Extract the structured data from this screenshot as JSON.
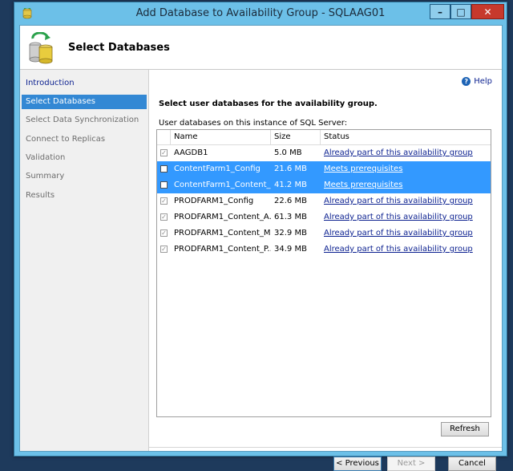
{
  "window": {
    "title": "Add Database to Availability Group - SQLAAG01",
    "controls": {
      "minimize": "–",
      "maximize": "□",
      "close": "✕"
    }
  },
  "header": {
    "title": "Select Databases",
    "icon": "database-cylinders-icon"
  },
  "nav": {
    "items": [
      {
        "label": "Introduction"
      },
      {
        "label": "Select Databases"
      },
      {
        "label": "Select Data Synchronization"
      },
      {
        "label": "Connect to Replicas"
      },
      {
        "label": "Validation"
      },
      {
        "label": "Summary"
      },
      {
        "label": "Results"
      }
    ]
  },
  "main": {
    "help_label": "Help",
    "section_title": "Select user databases for the availability group.",
    "grid_label": "User databases on this instance of SQL Server:",
    "columns": {
      "name": "Name",
      "size": "Size",
      "status": "Status"
    },
    "rows": [
      {
        "name": "AAGDB1",
        "size": "5.0 MB",
        "status": "Already part of this availability group",
        "checked": true,
        "selected": false
      },
      {
        "name": "ContentFarm1_Config",
        "size": "21.6 MB",
        "status": "Meets prerequisites",
        "checked": false,
        "selected": true
      },
      {
        "name": "ContentFarm1_Content_...",
        "size": "41.2 MB",
        "status": "Meets prerequisites",
        "checked": false,
        "selected": true
      },
      {
        "name": "PRODFARM1_Config",
        "size": "22.6 MB",
        "status": "Already part of this availability group",
        "checked": true,
        "selected": false
      },
      {
        "name": "PRODFARM1_Content_A...",
        "size": "61.3 MB",
        "status": "Already part of this availability group",
        "checked": true,
        "selected": false
      },
      {
        "name": "PRODFARM1_Content_M...",
        "size": "32.9 MB",
        "status": "Already part of this availability group",
        "checked": true,
        "selected": false
      },
      {
        "name": "PRODFARM1_Content_P...",
        "size": "34.9 MB",
        "status": "Already part of this availability group",
        "checked": true,
        "selected": false
      }
    ],
    "refresh_label": "Refresh"
  },
  "footer": {
    "previous_label": "< Previous",
    "next_label": "Next >",
    "cancel_label": "Cancel"
  },
  "colors": {
    "titlebar": "#6cc0e8",
    "selection": "#3399ff",
    "nav_active": "#3388d4",
    "close_button": "#c7392c",
    "link": "#0a1f8f"
  }
}
